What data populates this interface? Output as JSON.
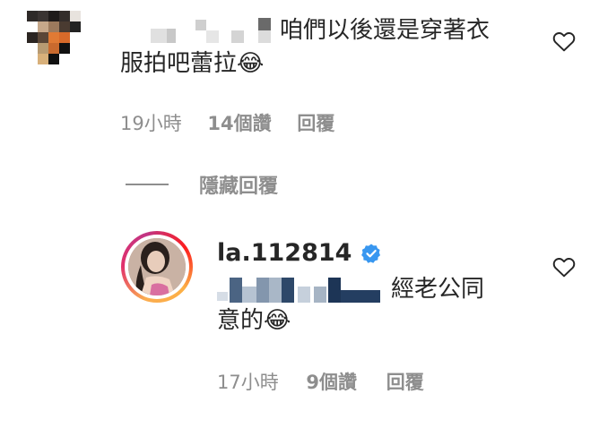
{
  "comment": {
    "text": "咱們以後還是穿著衣服拍吧蕾拉😂",
    "text_line1": "咱們以後還是穿著衣",
    "text_line2": "服拍吧蕾拉😂",
    "time": "19小時",
    "likes": "14個讚",
    "reply_label": "回覆"
  },
  "hide_replies_label": "隱藏回覆",
  "reply": {
    "username": "la.112814",
    "verified": true,
    "text": "經老公同意的😂",
    "text_line1": "經老公同",
    "text_line2": "意的😂",
    "time": "17小時",
    "likes": "9個讚",
    "reply_label": "回覆"
  },
  "icons": {
    "like": "heart-outline-icon",
    "verified": "verified-badge-icon"
  },
  "colors": {
    "text": "#262626",
    "muted": "#8e8e8e",
    "verified": "#3897f0"
  }
}
